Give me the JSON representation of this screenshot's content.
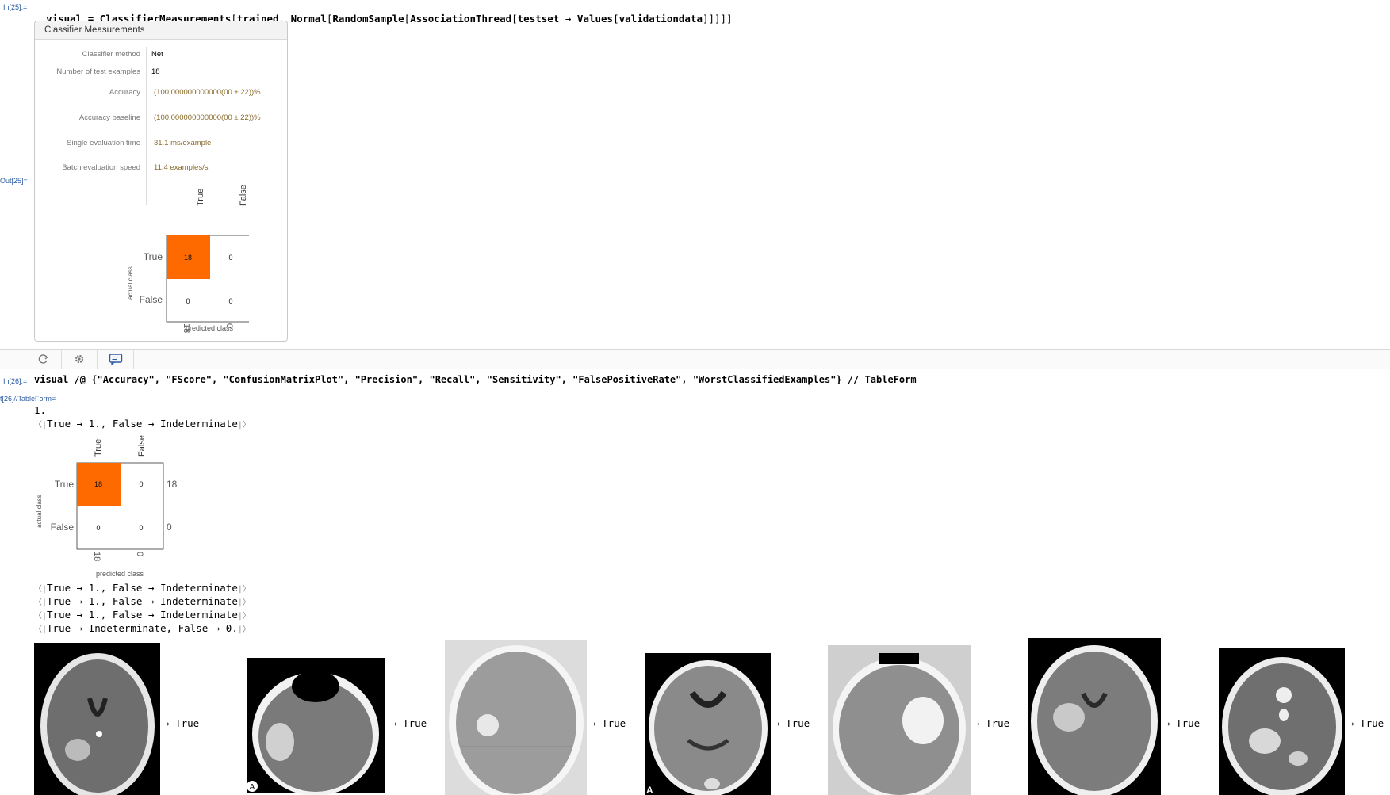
{
  "cell1": {
    "in_label": "In[25]:=",
    "code_parts": [
      "visual",
      " = ",
      "ClassifierMeasurements",
      "[",
      "trained",
      ", ",
      "Normal",
      "[",
      "RandomSample",
      "[",
      "AssociationThread",
      "[",
      "testset",
      " → ",
      "Values",
      "[",
      "validationdata",
      "]]]]]"
    ],
    "out_label": "Out[25]="
  },
  "panel": {
    "title": "Classifier Measurements",
    "rows": [
      {
        "label": "Classifier method",
        "value": "Net"
      },
      {
        "label": "Number of test examples",
        "value": "18"
      },
      {
        "label": "Accuracy",
        "value": "(100.000000000000(00 ± 22))%"
      },
      {
        "label": "Accuracy baseline",
        "value": "(100.000000000000(00 ± 22))%"
      },
      {
        "label": "Single evaluation time",
        "value": "31.1 ms/example"
      },
      {
        "label": "Batch evaluation speed",
        "value": "11.4 examples/s"
      }
    ]
  },
  "confusion_matrix": {
    "classes": [
      "True",
      "False"
    ],
    "matrix": [
      [
        18,
        0
      ],
      [
        0,
        0
      ]
    ],
    "row_totals": [
      18,
      0
    ],
    "col_totals": [
      18,
      0
    ],
    "xlabel": "predicted class",
    "ylabel": "actual class",
    "highlight_color": "#ff6a00"
  },
  "cell2": {
    "in_label": "In[26]:=",
    "code": "visual /@ {\"Accuracy\", \"FScore\", \"ConfusionMatrixPlot\", \"Precision\", \"Recall\", \"Sensitivity\", \"FalsePositiveRate\", \"WorstClassifiedExamples\"} // TableForm",
    "out_label": "t[26]//TableForm="
  },
  "results": {
    "accuracy": "1.",
    "fscore": "True → 1., False → Indeterminate",
    "precision": "True → 1., False → Indeterminate",
    "recall": "True → 1., False → Indeterminate",
    "sensitivity": "True → 1., False → Indeterminate",
    "false_positive_rate": "True → Indeterminate, False → 0."
  },
  "worst_examples": {
    "result_label": "→ True",
    "images": [
      {
        "name": "ct-scan-1",
        "marker": ""
      },
      {
        "name": "ct-scan-2",
        "marker": "A"
      },
      {
        "name": "ct-scan-3",
        "marker": ""
      },
      {
        "name": "ct-scan-4",
        "marker": "A"
      },
      {
        "name": "ct-scan-5",
        "marker": ""
      },
      {
        "name": "ct-scan-6",
        "marker": ""
      },
      {
        "name": "ct-scan-7",
        "marker": ""
      }
    ]
  },
  "toolbar": {
    "icons": [
      "refresh-icon",
      "gear-icon",
      "chat-icon"
    ],
    "accent": "#2b5ba3"
  }
}
